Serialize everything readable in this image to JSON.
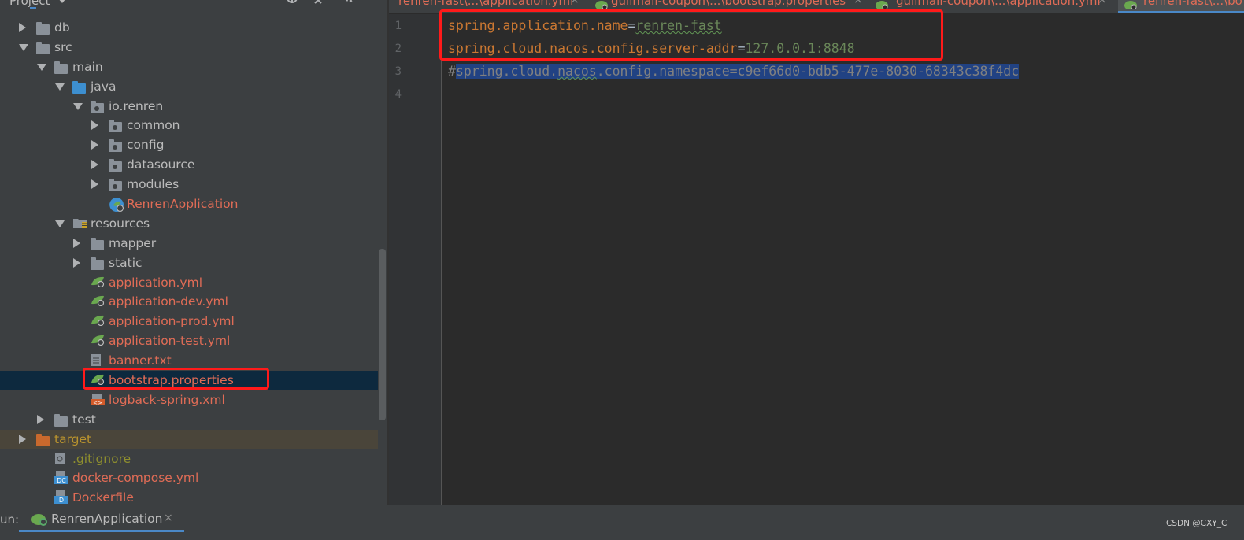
{
  "project_panel": {
    "title": "Project",
    "tree": [
      {
        "depth": 0,
        "state": "collapsed",
        "icon": "folder",
        "label": "db",
        "color": "dir"
      },
      {
        "depth": 0,
        "state": "expanded",
        "icon": "folder",
        "label": "src",
        "color": "dir"
      },
      {
        "depth": 1,
        "state": "expanded",
        "icon": "folder",
        "label": "main",
        "color": "dir"
      },
      {
        "depth": 2,
        "state": "expanded",
        "icon": "folder-blue",
        "label": "java",
        "color": "dir"
      },
      {
        "depth": 3,
        "state": "expanded",
        "icon": "package",
        "label": "io.renren",
        "color": "dir"
      },
      {
        "depth": 4,
        "state": "collapsed",
        "icon": "package",
        "label": "common",
        "color": "dir"
      },
      {
        "depth": 4,
        "state": "collapsed",
        "icon": "package",
        "label": "config",
        "color": "dir"
      },
      {
        "depth": 4,
        "state": "collapsed",
        "icon": "package",
        "label": "datasource",
        "color": "dir"
      },
      {
        "depth": 4,
        "state": "collapsed",
        "icon": "package",
        "label": "modules",
        "color": "dir"
      },
      {
        "depth": 4,
        "state": "none",
        "icon": "spring-boot-class",
        "label": "RenrenApplication",
        "color": "mod"
      },
      {
        "depth": 2,
        "state": "expanded",
        "icon": "resources-folder",
        "label": "resources",
        "color": "dir"
      },
      {
        "depth": 3,
        "state": "collapsed",
        "icon": "folder",
        "label": "mapper",
        "color": "dir"
      },
      {
        "depth": 3,
        "state": "collapsed",
        "icon": "folder",
        "label": "static",
        "color": "dir"
      },
      {
        "depth": 3,
        "state": "none",
        "icon": "spring-config",
        "label": "application.yml",
        "color": "mod"
      },
      {
        "depth": 3,
        "state": "none",
        "icon": "spring-config",
        "label": "application-dev.yml",
        "color": "mod"
      },
      {
        "depth": 3,
        "state": "none",
        "icon": "spring-config",
        "label": "application-prod.yml",
        "color": "mod"
      },
      {
        "depth": 3,
        "state": "none",
        "icon": "spring-config",
        "label": "application-test.yml",
        "color": "mod"
      },
      {
        "depth": 3,
        "state": "none",
        "icon": "text-file",
        "label": "banner.txt",
        "color": "mod"
      },
      {
        "depth": 3,
        "state": "none",
        "icon": "spring-config",
        "label": "bootstrap.properties",
        "color": "mod",
        "selected": true
      },
      {
        "depth": 3,
        "state": "none",
        "icon": "xml-file",
        "label": "logback-spring.xml",
        "color": "mod"
      },
      {
        "depth": 1,
        "state": "collapsed",
        "icon": "folder",
        "label": "test",
        "color": "dir"
      },
      {
        "depth": 0,
        "state": "collapsed",
        "icon": "folder-orange",
        "label": "target",
        "color": "tgt",
        "excluded": true
      },
      {
        "depth": 1,
        "state": "none",
        "icon": "ignore-file",
        "label": ".gitignore",
        "color": "ign"
      },
      {
        "depth": 1,
        "state": "none",
        "icon": "docker-compose-file",
        "label": "docker-compose.yml",
        "color": "mod"
      },
      {
        "depth": 1,
        "state": "none",
        "icon": "docker-file",
        "label": "Dockerfile",
        "color": "mod"
      }
    ]
  },
  "editor_tabs": [
    {
      "label": "renren-fast\\...\\application.yml",
      "active": false,
      "icon": "none"
    },
    {
      "label": "gulimall-coupon\\...\\bootstrap.properties",
      "active": false,
      "icon": "spring-config-icon"
    },
    {
      "label": "gulimall-coupon\\...\\application.yml",
      "active": false,
      "icon": "spring-config-icon"
    },
    {
      "label": "renren-fast\\...\\bo",
      "active": true,
      "icon": "spring-config-icon"
    }
  ],
  "editor": {
    "line_numbers": [
      "1",
      "2",
      "3",
      "4"
    ],
    "lines": {
      "l1_key": "spring.application.name",
      "l1_eq": "=",
      "l1_value": "renren-fast",
      "l2_key": "spring.cloud.nacos.config.server-addr",
      "l2_eq": "=",
      "l2_value": "127.0.0.1:8848",
      "l3_hash": "#",
      "l3_comment": "spring.cloud.nacos.config.namespace=c9ef66d0-bdb5-477e-8030-68343c38f4dc"
    }
  },
  "run_bar": {
    "label": "un:",
    "tab_label": "RenrenApplication",
    "close": "×"
  },
  "watermark": "CSDN @CXY_C",
  "colors": {
    "modified_file": "#e06c56",
    "directory": "#bbbbbb",
    "selection": "#214283",
    "annotation_box": "#ff1a1a",
    "key": "#cc7832",
    "value": "#6a8759"
  }
}
